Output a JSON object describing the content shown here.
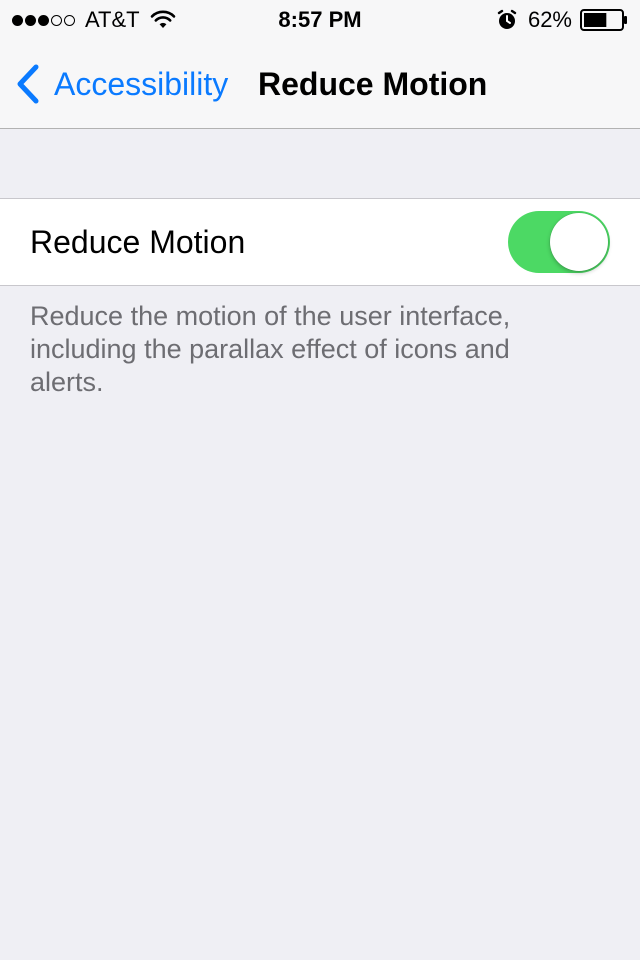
{
  "status_bar": {
    "signal": {
      "filled": 3,
      "total": 5
    },
    "carrier": "AT&T",
    "time": "8:57 PM",
    "battery_percent": "62%",
    "battery_level": 0.62,
    "icons": [
      "signal-dots",
      "wifi-icon",
      "alarm-icon",
      "battery-icon"
    ]
  },
  "nav": {
    "back_label": "Accessibility",
    "title": "Reduce Motion",
    "back_icon": "chevron-left-icon"
  },
  "settings": {
    "row_label": "Reduce Motion",
    "toggle_on": true,
    "footer": "Reduce the motion of the user interface, including the parallax effect of icons and alerts."
  },
  "colors": {
    "accent": "#0a7aff",
    "toggle_on": "#4cd964",
    "background": "#efeff4",
    "footer_text": "#6d6d72"
  }
}
